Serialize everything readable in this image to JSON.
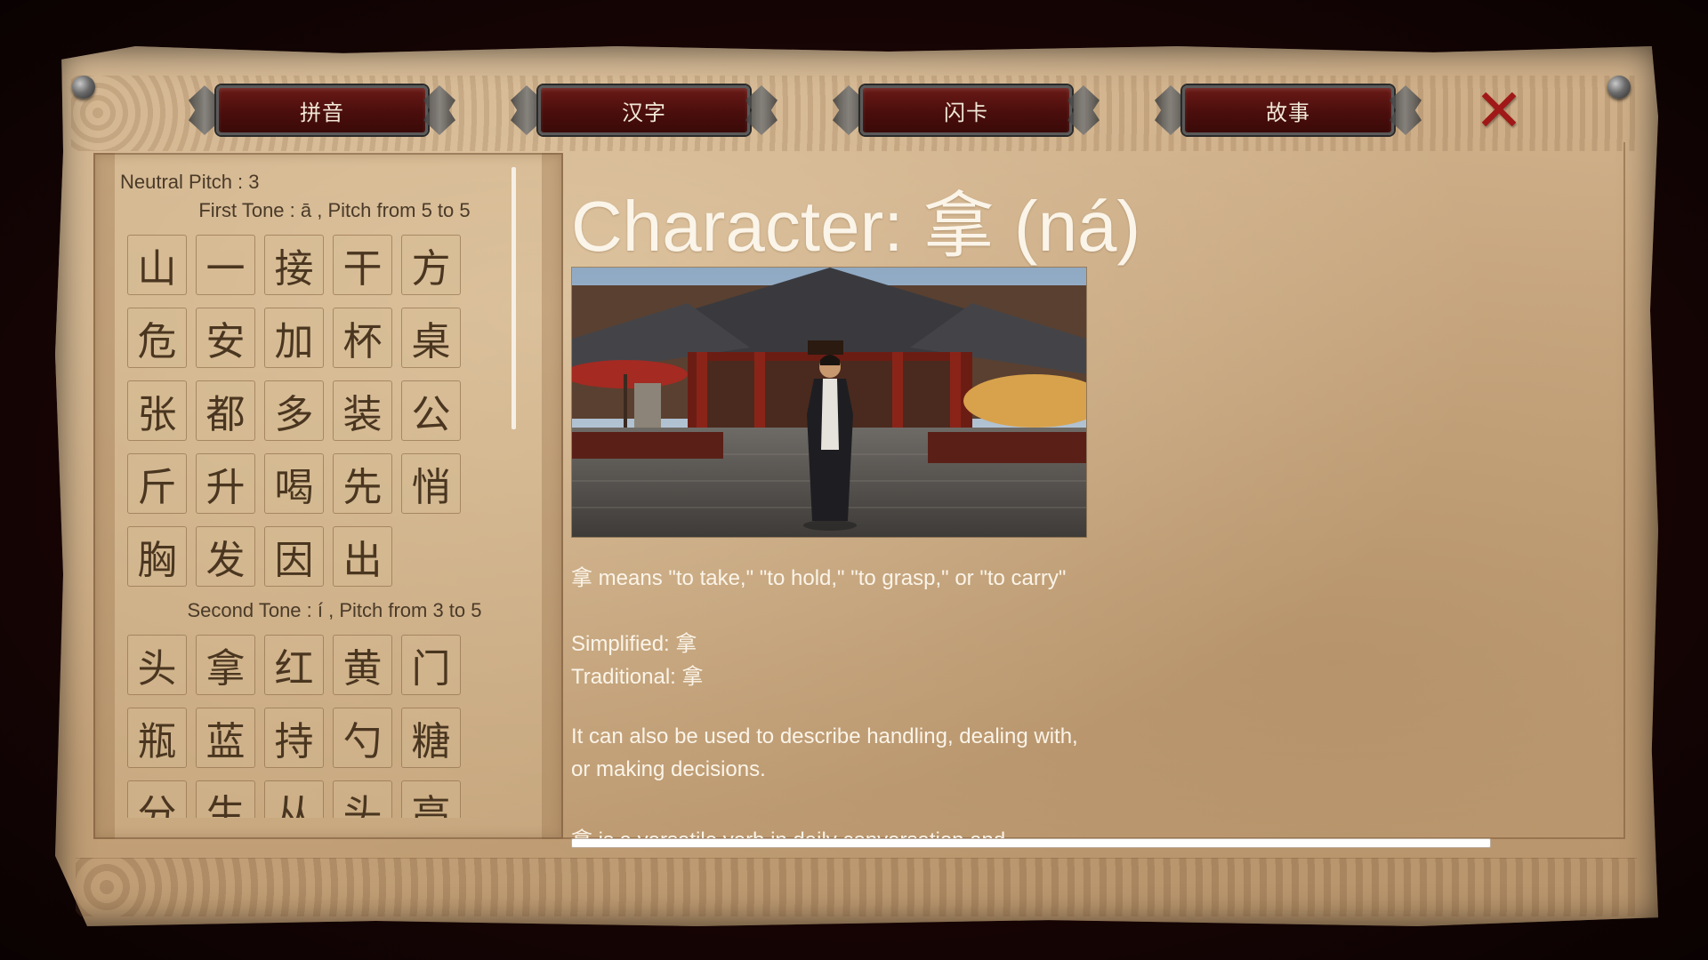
{
  "tabs": [
    {
      "label": "拼音"
    },
    {
      "label": "汉字"
    },
    {
      "label": "闪卡"
    },
    {
      "label": "故事"
    }
  ],
  "close_icon": "close-x-icon",
  "left_panel": {
    "neutral_heading": "Neutral Pitch : 3",
    "first_tone_heading": "First Tone : ā , Pitch from 5 to 5",
    "first_tone_chars": [
      "山",
      "一",
      "接",
      "干",
      "方",
      "危",
      "安",
      "加",
      "杯",
      "桌",
      "张",
      "都",
      "多",
      "装",
      "公",
      "斤",
      "升",
      "喝",
      "先",
      "悄",
      "胸",
      "发",
      "因",
      "出"
    ],
    "second_tone_heading": "Second Tone : í , Pitch from 3 to 5",
    "second_tone_chars": [
      "头",
      "拿",
      "红",
      "黄",
      "门",
      "瓶",
      "蓝",
      "持",
      "勺",
      "糖",
      "分",
      "生",
      "从",
      "头",
      "高"
    ]
  },
  "detail": {
    "title": "Character: 拿 (ná)",
    "meaning": "拿 means \"to take,\" \"to hold,\" \"to grasp,\" or \"to carry\"",
    "simplified": "Simplified: 拿",
    "traditional": "Traditional: 拿",
    "extra_line1": "It can also be used to describe handling, dealing with,",
    "extra_line2": "or making decisions.",
    "cut_off_line": "拿 is a versatile verb in daily conversation and"
  },
  "colors": {
    "tab_fill": "#4a0e0c",
    "close_icon": "#a01818",
    "parchment": "#c8a77f",
    "detail_text": "#fbf4e8"
  }
}
